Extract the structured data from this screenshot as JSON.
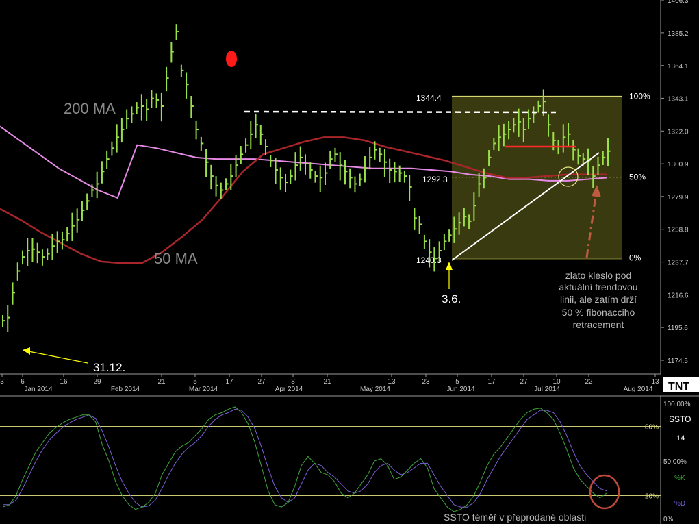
{
  "colors": {
    "background": "#000000",
    "price_bar": "#9ae04a",
    "ma200": "#e68ae6",
    "ma50": "#a8262a",
    "fib_box": "#3a3a10",
    "fib_line": "#d8d870",
    "k_line": "#3ea83e",
    "d_line": "#7a62d8",
    "stoch_level": "#e6e682",
    "annotation_arrow": "#ffff00",
    "red_marker": "#ff1a1a",
    "circle_stoch": "#c04a3a",
    "resistance": "#ff2a2a"
  },
  "logo": "TNT",
  "chart_data": [
    {
      "type": "line",
      "title": "",
      "ylim": [
        1160,
        1410
      ],
      "y_ticks": [
        "1406.3",
        "1385.2",
        "1364.1",
        "1343.1",
        "1322.0",
        "1300.9",
        "1279.9",
        "1258.8",
        "1237.7",
        "1216.6",
        "1195.6",
        "1174.5"
      ],
      "x_day_ticks": [
        "3",
        "6",
        "16",
        "29",
        "21",
        "5",
        "17",
        "27",
        "8",
        "21",
        "13",
        "23",
        "5",
        "17",
        "27",
        "10",
        "22",
        "13"
      ],
      "x_month_ticks": [
        "Jan 2014",
        "Feb 2014",
        "Mar 2014",
        "Apr 2014",
        "May 2014",
        "Jun 2014",
        "Jul 2014",
        "Aug 2014"
      ],
      "series": [
        {
          "name": "200 MA",
          "values": [
            1325,
            1316,
            1307,
            1298,
            1291,
            1284,
            1279,
            1313,
            1311,
            1308,
            1305,
            1304,
            1304,
            1304,
            1303,
            1302,
            1301,
            1300,
            1299,
            1298,
            1298,
            1298,
            1297,
            1296,
            1294,
            1293,
            1291,
            1291,
            1290,
            1290,
            1291,
            1292
          ]
        },
        {
          "name": "50 MA",
          "values": [
            1272,
            1265,
            1257,
            1250,
            1243,
            1238,
            1237,
            1237,
            1244,
            1254,
            1265,
            1280,
            1296,
            1307,
            1311,
            1315,
            1318,
            1318,
            1316,
            1312,
            1309,
            1306,
            1303,
            1299,
            1295,
            1292,
            1292,
            1293,
            1294,
            1294,
            1294
          ]
        },
        {
          "name": "price",
          "values": [
            1200,
            1202,
            1218,
            1232,
            1241,
            1245,
            1246,
            1244,
            1241,
            1243,
            1248,
            1251,
            1252,
            1256,
            1261,
            1265,
            1271,
            1277,
            1284,
            1288,
            1296,
            1304,
            1311,
            1318,
            1323,
            1330,
            1333,
            1337,
            1338,
            1336,
            1343,
            1342,
            1338,
            1356,
            1373,
            1386,
            1361,
            1352,
            1338,
            1323,
            1314,
            1302,
            1293,
            1287,
            1284,
            1288,
            1293,
            1300,
            1307,
            1313,
            1320,
            1326,
            1320,
            1312,
            1303,
            1297,
            1292,
            1289,
            1293,
            1300,
            1305,
            1301,
            1297,
            1293,
            1292,
            1295,
            1304,
            1307,
            1300,
            1296,
            1292,
            1288,
            1291,
            1298,
            1305,
            1310,
            1307,
            1302,
            1297,
            1296,
            1295,
            1293,
            1286,
            1266,
            1262,
            1251,
            1244,
            1240,
            1245,
            1251,
            1255,
            1259,
            1263,
            1267,
            1264,
            1274,
            1288,
            1292,
            1305,
            1314,
            1318,
            1320,
            1323,
            1326,
            1328,
            1323,
            1330,
            1333,
            1338,
            1341,
            1326,
            1316,
            1312,
            1318,
            1320,
            1310,
            1306,
            1304,
            1303,
            1293,
            1300,
            1305,
            1309
          ]
        }
      ],
      "fib_levels": [
        {
          "label": "100%",
          "value": 1344.4
        },
        {
          "label": "50%",
          "value": 1292.3
        },
        {
          "label": "0%",
          "value": 1240.3
        }
      ],
      "annotations": {
        "ma200_label": "200 MA",
        "ma50_label": "50 MA",
        "high_label": "1344.4",
        "mid_label": "1292.3",
        "low_label": "1240.3",
        "date_jun": "3.6.",
        "date_dec": "31.12.",
        "note_lines": [
          "zlato kleslo pod",
          "aktuální  trendovou",
          "linii, ale zatím drží",
          "50 % fibonacciho",
          "retracement"
        ]
      }
    },
    {
      "type": "line",
      "title": "SSTO",
      "ylim": [
        0,
        100
      ],
      "y_ticks": [
        "100.00%",
        "80%",
        "50.00%",
        "20%",
        "0%"
      ],
      "levels": [
        80,
        20
      ],
      "side_labels": {
        "name": "SSTO",
        "period": "14",
        "k": "%K",
        "d": "%D"
      },
      "series": [
        {
          "name": "%K",
          "values": [
            10,
            12,
            20,
            34,
            46,
            58,
            66,
            74,
            79,
            83,
            86,
            88,
            90,
            90,
            84,
            64,
            50,
            32,
            20,
            12,
            8,
            10,
            14,
            22,
            38,
            48,
            58,
            63,
            66,
            72,
            78,
            86,
            90,
            92,
            95,
            97,
            92,
            82,
            66,
            45,
            24,
            12,
            10,
            14,
            28,
            46,
            54,
            48,
            40,
            38,
            32,
            22,
            18,
            22,
            30,
            38,
            50,
            52,
            46,
            34,
            36,
            42,
            48,
            52,
            44,
            26,
            18,
            10,
            6,
            8,
            12,
            20,
            32,
            46,
            56,
            62,
            70,
            78,
            86,
            92,
            95,
            96,
            92,
            86,
            74,
            60,
            44,
            34,
            28,
            22,
            18,
            22
          ]
        },
        {
          "name": "%D",
          "values": [
            12,
            12,
            16,
            26,
            38,
            50,
            60,
            68,
            74,
            79,
            83,
            86,
            88,
            90,
            87,
            76,
            62,
            46,
            32,
            22,
            14,
            10,
            11,
            16,
            26,
            38,
            48,
            56,
            62,
            66,
            72,
            80,
            86,
            90,
            92,
            95,
            94,
            88,
            78,
            62,
            44,
            28,
            18,
            14,
            18,
            30,
            42,
            48,
            46,
            40,
            36,
            30,
            24,
            22,
            24,
            30,
            40,
            46,
            48,
            42,
            38,
            40,
            44,
            48,
            48,
            38,
            28,
            20,
            12,
            10,
            10,
            14,
            22,
            34,
            44,
            54,
            62,
            70,
            78,
            86,
            90,
            94,
            94,
            92,
            84,
            72,
            58,
            46,
            38,
            32,
            26,
            24
          ]
        }
      ],
      "note": "SSTO téměř v přeprodané oblasti"
    }
  ]
}
